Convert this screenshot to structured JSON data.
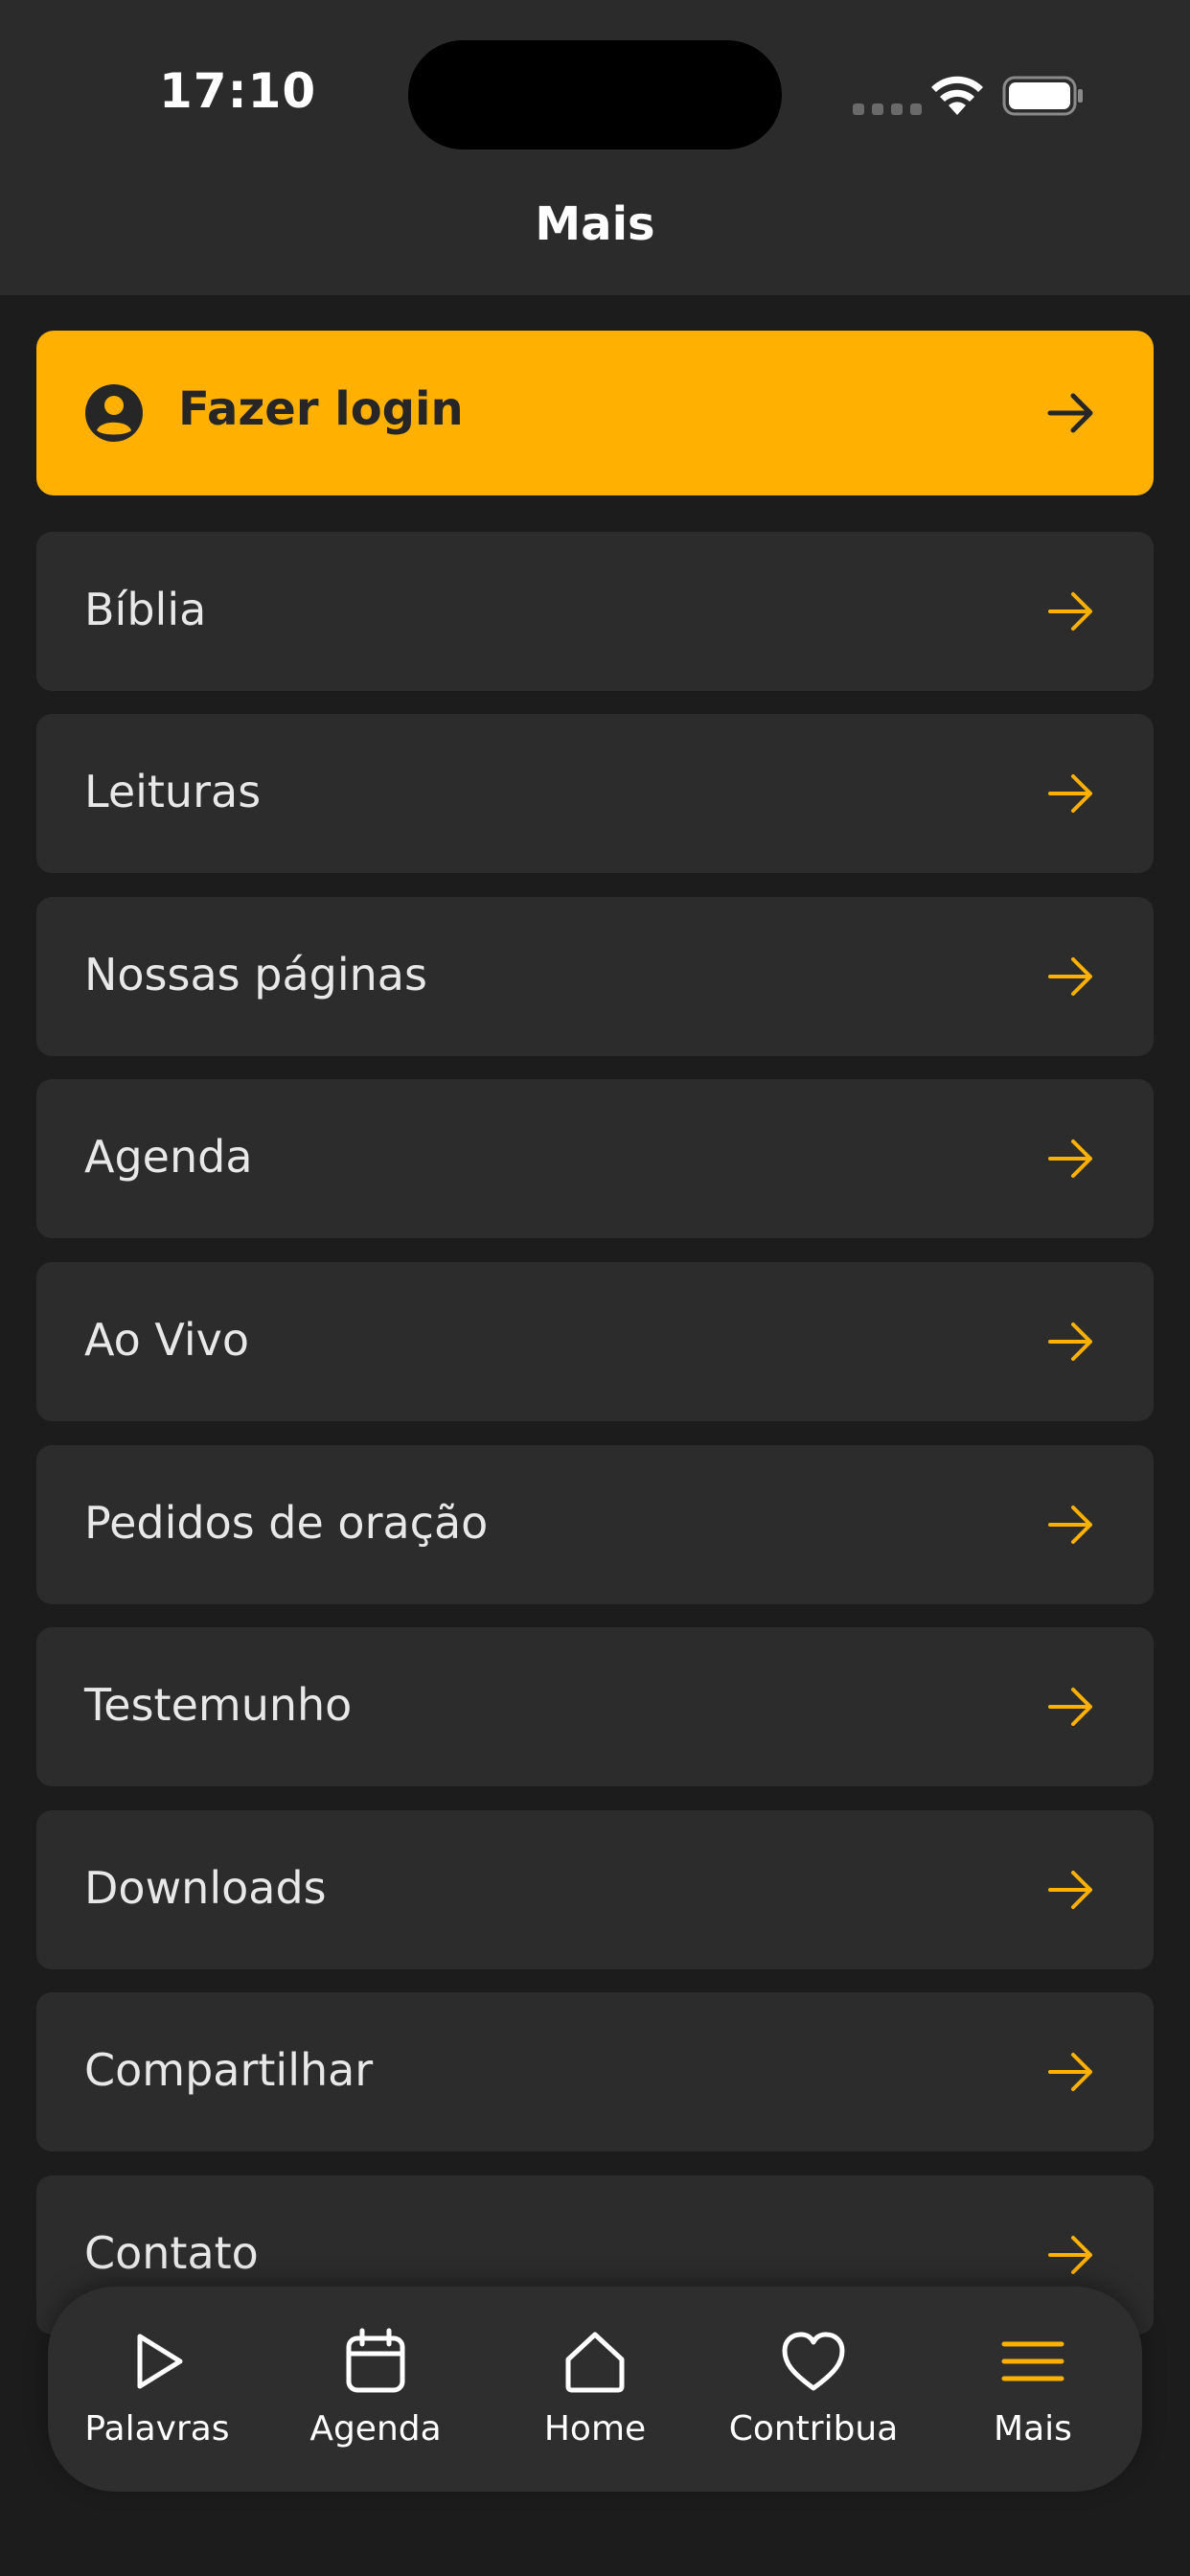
{
  "status_bar": {
    "time": "17:10"
  },
  "header": {
    "title": "Mais"
  },
  "login": {
    "label": "Fazer login",
    "icon": "user-circle-icon"
  },
  "menu": {
    "items": [
      {
        "label": "Bíblia"
      },
      {
        "label": "Leituras"
      },
      {
        "label": "Nossas páginas"
      },
      {
        "label": "Agenda"
      },
      {
        "label": "Ao Vivo"
      },
      {
        "label": "Pedidos de oração"
      },
      {
        "label": "Testemunho"
      },
      {
        "label": "Downloads"
      },
      {
        "label": "Compartilhar"
      },
      {
        "label": "Contato"
      }
    ]
  },
  "tab_bar": {
    "tabs": [
      {
        "label": "Palavras",
        "icon": "play-icon"
      },
      {
        "label": "Agenda",
        "icon": "calendar-icon"
      },
      {
        "label": "Home",
        "icon": "home-icon"
      },
      {
        "label": "Contribua",
        "icon": "heart-icon"
      },
      {
        "label": "Mais",
        "icon": "menu-icon",
        "active": true
      }
    ]
  },
  "colors": {
    "accent": "#ffb000",
    "background": "#1c1c1c",
    "header": "#2b2b2b",
    "card": "#2c2c2c"
  }
}
